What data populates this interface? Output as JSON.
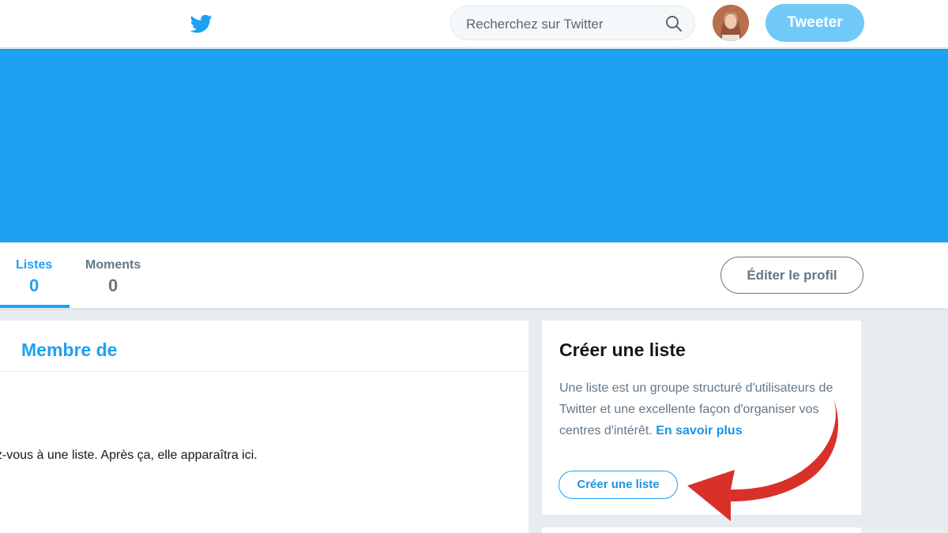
{
  "topbar": {
    "search_placeholder": "Recherchez sur Twitter",
    "tweet_label": "Tweeter",
    "logo_icon": "twitter-bird-icon",
    "search_icon": "search-icon"
  },
  "profile_nav": {
    "stats": [
      {
        "label": "Listes",
        "value": "0"
      },
      {
        "label": "Moments",
        "value": "0"
      }
    ],
    "edit_label": "Éditer le profil"
  },
  "main": {
    "title": "Membre de",
    "empty_text": "ez-vous à une liste. Après ça, elle apparaîtra ici."
  },
  "side": {
    "title": "Créer une liste",
    "description": "Une liste est un groupe structuré d'utilisateurs de Twitter et une excellente façon d'organiser vos centres d'intérêt.",
    "learn_more": "En savoir plus",
    "button_label": "Créer une liste"
  },
  "colors": {
    "accent": "#1da1f2",
    "tweet_button": "#71c9f8",
    "arrow": "#d9302a"
  }
}
